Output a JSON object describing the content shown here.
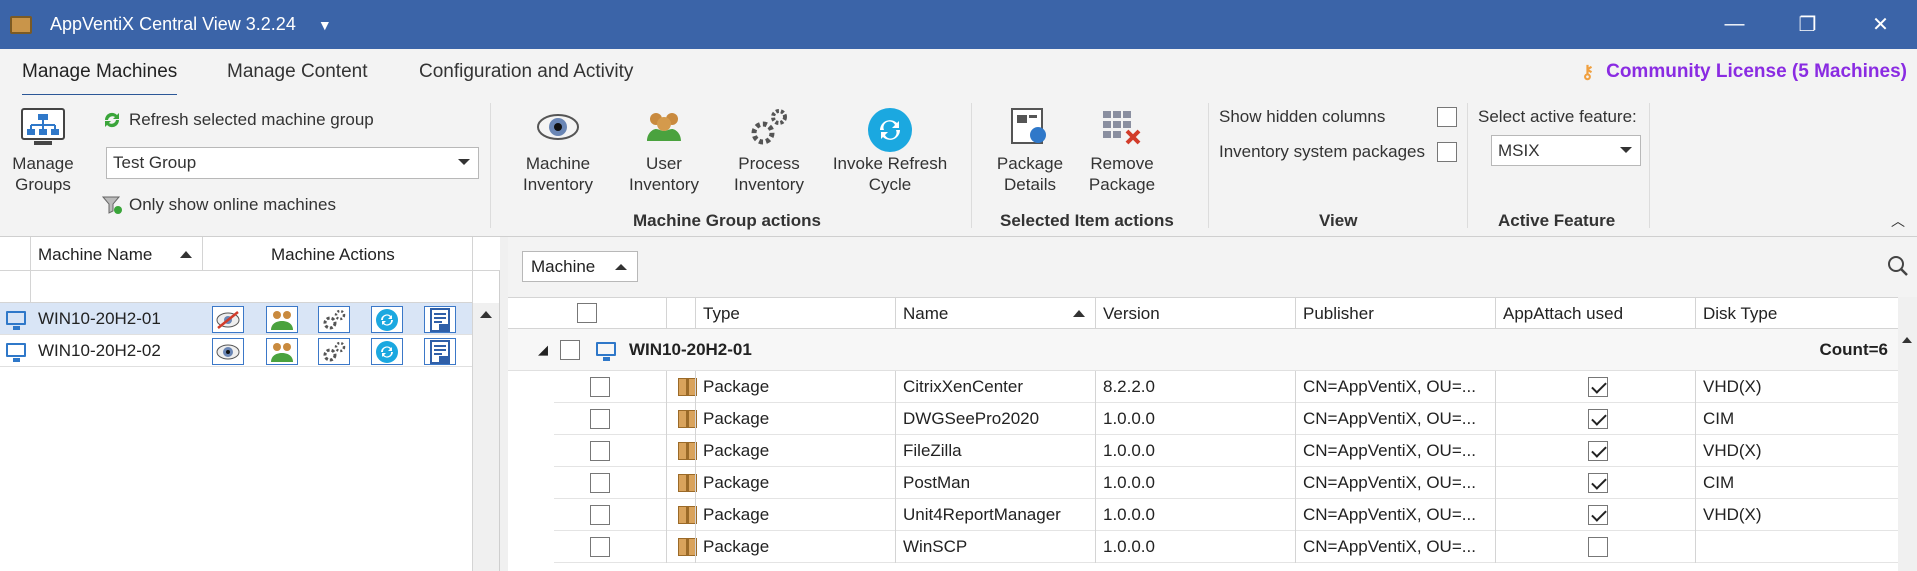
{
  "window": {
    "title": "AppVentiX Central View 3.2.24",
    "minimize": "—",
    "maximize": "❐",
    "close": "✕"
  },
  "tabs": [
    "Manage Machines",
    "Manage Content",
    "Configuration and Activity"
  ],
  "license": "Community License (5 Machines)",
  "ribbon": {
    "manage_groups": "Manage Groups",
    "refresh_group": "Refresh selected machine group",
    "group_select": "Test Group",
    "only_online": "Only show online machines",
    "machine_inventory": "Machine Inventory",
    "user_inventory": "User Inventory",
    "process_inventory": "Process Inventory",
    "invoke_refresh": "Invoke Refresh Cycle",
    "group_actions_label": "Machine Group actions",
    "package_details": "Package Details",
    "remove_package": "Remove Package",
    "item_actions_label": "Selected Item actions",
    "show_hidden": "Show hidden columns",
    "inventory_system": "Inventory system packages",
    "view_label": "View",
    "select_feature": "Select active feature:",
    "feature_value": "MSIX",
    "active_feature_label": "Active Feature"
  },
  "machines_panel": {
    "col_name": "Machine Name",
    "col_actions": "Machine Actions",
    "rows": [
      "WIN10-20H2-01",
      "WIN10-20H2-02"
    ]
  },
  "grid": {
    "group_by": "Machine",
    "columns": [
      "Type",
      "Name",
      "Version",
      "Publisher",
      "AppAttach used",
      "Disk Type"
    ],
    "group_name": "WIN10-20H2-01",
    "group_count": "Count=6",
    "rows": [
      {
        "type": "Package",
        "name": "CitrixXenCenter",
        "version": "8.2.2.0",
        "publisher": "CN=AppVentiX, OU=...",
        "appattach": true,
        "disk": "VHD(X)"
      },
      {
        "type": "Package",
        "name": "DWGSeePro2020",
        "version": "1.0.0.0",
        "publisher": "CN=AppVentiX, OU=...",
        "appattach": true,
        "disk": "CIM"
      },
      {
        "type": "Package",
        "name": "FileZilla",
        "version": "1.0.0.0",
        "publisher": "CN=AppVentiX, OU=...",
        "appattach": true,
        "disk": "VHD(X)"
      },
      {
        "type": "Package",
        "name": "PostMan",
        "version": "1.0.0.0",
        "publisher": "CN=AppVentiX, OU=...",
        "appattach": true,
        "disk": "CIM"
      },
      {
        "type": "Package",
        "name": "Unit4ReportManager",
        "version": "1.0.0.0",
        "publisher": "CN=AppVentiX, OU=...",
        "appattach": true,
        "disk": "VHD(X)"
      },
      {
        "type": "Package",
        "name": "WinSCP",
        "version": "1.0.0.0",
        "publisher": "CN=AppVentiX, OU=...",
        "appattach": false,
        "disk": ""
      }
    ]
  }
}
